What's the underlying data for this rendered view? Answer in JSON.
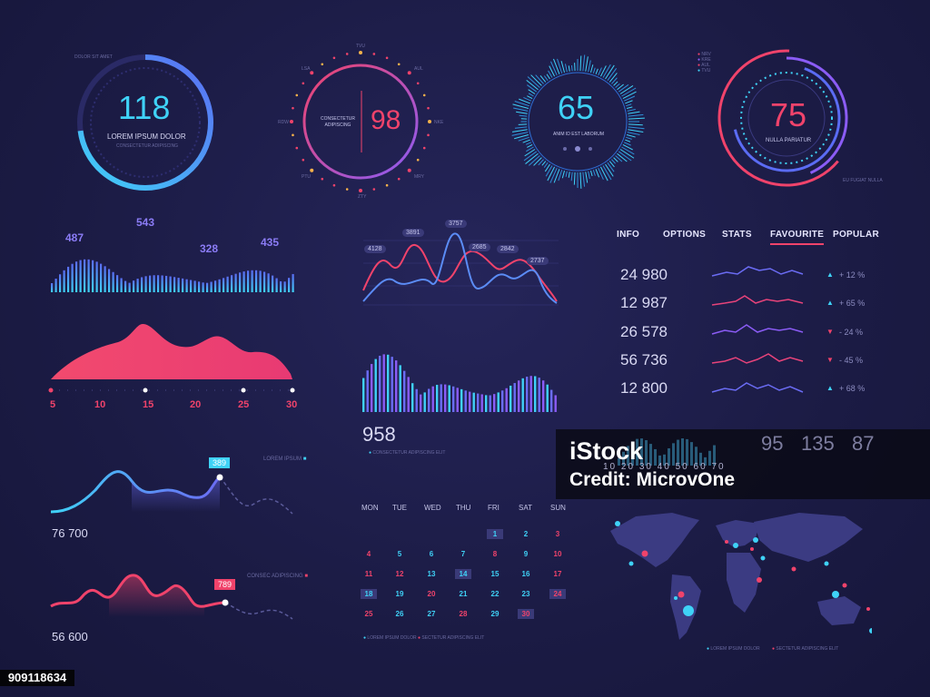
{
  "gauges": [
    {
      "value": "118",
      "label": "LOREM IPSUM DOLOR",
      "sub": "CONSECTETUR ADIPISCING",
      "top_label": "DOLOR SIT AMET"
    },
    {
      "value": "98",
      "label": "CONSECTETUR ADIPISCING",
      "ticks": [
        "TVU",
        "AUL",
        "NKE",
        "MRY",
        "ZTY",
        "PTU",
        "RDW",
        "LSA"
      ]
    },
    {
      "value": "65",
      "label": "ANIM ID EST LABORUM"
    },
    {
      "value": "75",
      "label": "NULLA PARIATUR",
      "legend": [
        "NRV",
        "KRE",
        "AUL",
        "TVU"
      ],
      "note": "EU FUGIAT NULLA"
    }
  ],
  "peaks": {
    "values": [
      "487",
      "543",
      "328",
      "435"
    ]
  },
  "scale": {
    "labels": [
      "5",
      "10",
      "15",
      "20",
      "25",
      "30"
    ]
  },
  "line_chart": {
    "tags": [
      "4128",
      "3891",
      "3757",
      "2685",
      "2842",
      "2737"
    ]
  },
  "bar_chart": {
    "value": "958",
    "caption": "CONSECTETUR ADIPISCING ELIT"
  },
  "tabs": [
    "INFO",
    "OPTIONS",
    "STATS",
    "FAVOURITE",
    "POPULAR"
  ],
  "active_tab": "FAVOURITE",
  "stats": [
    {
      "value": "24 980",
      "pct": "+ 12 %",
      "dir": "up"
    },
    {
      "value": "12 987",
      "pct": "+ 65 %",
      "dir": "up"
    },
    {
      "value": "26 578",
      "pct": "- 24 %",
      "dir": "down"
    },
    {
      "value": "56 736",
      "pct": "- 45 %",
      "dir": "down"
    },
    {
      "value": "12 800",
      "pct": "+ 68 %",
      "dir": "up"
    }
  ],
  "waves": [
    {
      "value": "76 700",
      "tag": "389",
      "legend": "LOREM IPSUM"
    },
    {
      "value": "56 600",
      "tag": "789",
      "legend": "CONSEC ADIPISCING"
    }
  ],
  "calendar": {
    "headers": [
      "MON",
      "TUE",
      "WED",
      "THU",
      "FRI",
      "SAT",
      "SUN"
    ],
    "weeks": [
      [
        "",
        "",
        "",
        "",
        "1",
        "2",
        "3"
      ],
      [
        "4",
        "5",
        "6",
        "7",
        "8",
        "9",
        "10"
      ],
      [
        "11",
        "12",
        "13",
        "14",
        "15",
        "16",
        "17"
      ],
      [
        "18",
        "19",
        "20",
        "21",
        "22",
        "23",
        "24"
      ],
      [
        "25",
        "26",
        "27",
        "28",
        "29",
        "30",
        ""
      ]
    ],
    "legend": [
      "LOREM IPSUM DOLOR",
      "SECTETUR ADIPISCING ELIT"
    ]
  },
  "overlay_numbers": [
    "95",
    "135",
    "87"
  ],
  "overlay_axis": [
    "10",
    "20",
    "30",
    "40",
    "50",
    "60",
    "70"
  ],
  "map": {
    "legend": [
      "LOREM IPSUM DOLOR",
      "SECTETUR ADIPISCING ELIT"
    ]
  },
  "watermark": {
    "brand": "iStock",
    "credit": "Credit: MicrovOne",
    "id": "909118634"
  },
  "colors": {
    "cyan": "#3fd2f7",
    "blue": "#5b6cf4",
    "pink": "#f0436b",
    "purple": "#8b5cf6",
    "bg": "#1d1d47"
  }
}
